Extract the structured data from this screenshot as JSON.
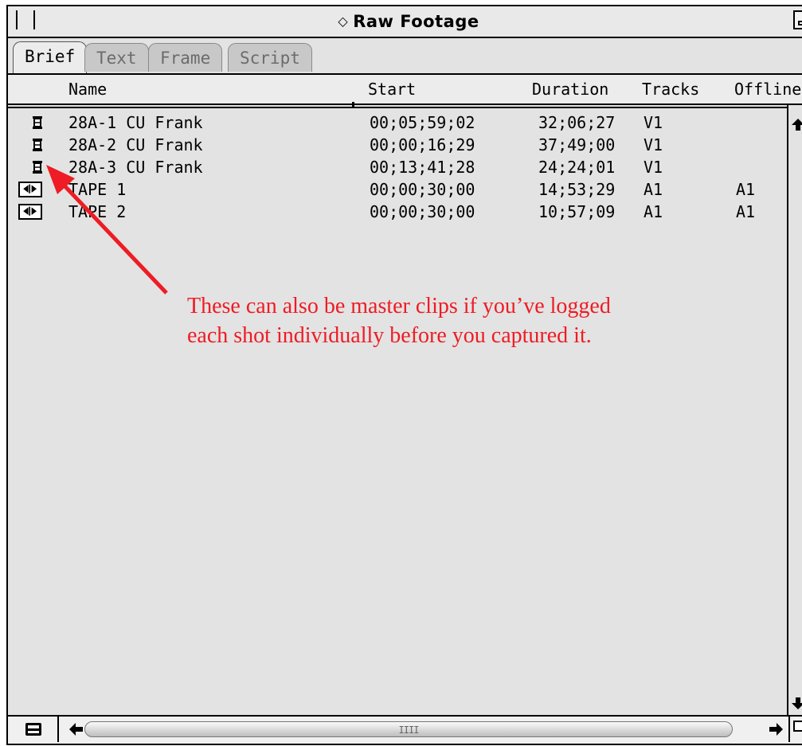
{
  "window": {
    "title": "Raw Footage",
    "title_marker": "◇"
  },
  "tabs": [
    {
      "label": "Brief",
      "active": true
    },
    {
      "label": "Text",
      "active": false
    },
    {
      "label": "Frame",
      "active": false
    },
    {
      "label": "Script",
      "active": false
    }
  ],
  "columns": {
    "name": "Name",
    "start": "Start",
    "duration": "Duration",
    "tracks": "Tracks",
    "offline": "Offline"
  },
  "rows": [
    {
      "icon": "clip-icon",
      "name": "28A-1 CU Frank",
      "start": "00;05;59;02",
      "duration": "32;06;27",
      "tracks": "V1",
      "offline": ""
    },
    {
      "icon": "clip-icon",
      "name": "28A-2 CU Frank",
      "start": "00;00;16;29",
      "duration": "37;49;00",
      "tracks": "V1",
      "offline": ""
    },
    {
      "icon": "clip-icon",
      "name": "28A-3 CU Frank",
      "start": "00;13;41;28",
      "duration": "24;24;01",
      "tracks": "V1",
      "offline": ""
    },
    {
      "icon": "audio-clip-icon",
      "name": "TAPE 1",
      "start": "00;00;30;00",
      "duration": "14;53;29",
      "tracks": "A1",
      "offline": "A1"
    },
    {
      "icon": "audio-clip-icon",
      "name": "TAPE 2",
      "start": "00;00;30;00",
      "duration": "10;57;09",
      "tracks": "A1",
      "offline": "A1"
    }
  ],
  "annotation": {
    "line1": "These can also be master clips if you’ve logged",
    "line2": "each shot individually before you captured it.",
    "color": "#ee1c24"
  },
  "scrollbar": {
    "grip": "IIII"
  },
  "colors": {
    "window_bg": "#e3e3e3",
    "annotation": "#ee1c24"
  }
}
